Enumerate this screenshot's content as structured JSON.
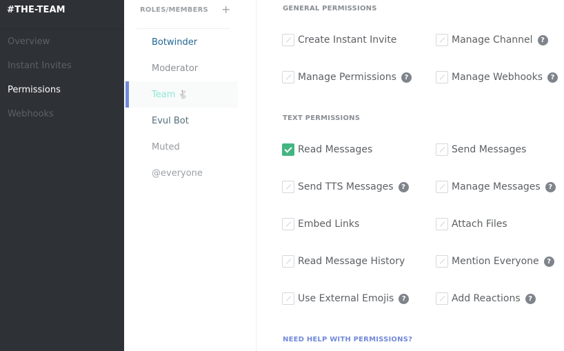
{
  "sidebar": {
    "title": "#THE-TEAM",
    "items": [
      {
        "label": "Overview",
        "active": false
      },
      {
        "label": "Instant Invites",
        "active": false
      },
      {
        "label": "Permissions",
        "active": true
      },
      {
        "label": "Webhooks",
        "active": false
      }
    ]
  },
  "roles": {
    "header": "ROLES/MEMBERS",
    "add_icon": "+",
    "items": [
      {
        "label": "Botwinder",
        "color": "#206694",
        "active": false,
        "badge": ""
      },
      {
        "label": "Moderator",
        "color": "#8a8e94",
        "active": false,
        "badge": ""
      },
      {
        "label": "Team",
        "color": "#8ee8d7",
        "active": true,
        "badge": "🐇"
      },
      {
        "label": "Evul Bot",
        "color": "#546e7a",
        "active": false,
        "badge": ""
      },
      {
        "label": "Muted",
        "color": "#95999e",
        "active": false,
        "badge": ""
      },
      {
        "label": "@everyone",
        "color": "#9ba0a6",
        "active": false,
        "badge": ""
      }
    ]
  },
  "permissions": {
    "general_header": "GENERAL PERMISSIONS",
    "general": [
      {
        "label": "Create Instant Invite",
        "state": "neutral",
        "help": false
      },
      {
        "label": "Manage Channel",
        "state": "neutral",
        "help": true
      },
      {
        "label": "Manage Permissions",
        "state": "neutral",
        "help": true
      },
      {
        "label": "Manage Webhooks",
        "state": "neutral",
        "help": true
      }
    ],
    "text_header": "TEXT PERMISSIONS",
    "text": [
      {
        "label": "Read Messages",
        "state": "allowed",
        "help": false
      },
      {
        "label": "Send Messages",
        "state": "neutral",
        "help": false
      },
      {
        "label": "Send TTS Messages",
        "state": "neutral",
        "help": true
      },
      {
        "label": "Manage Messages",
        "state": "neutral",
        "help": true
      },
      {
        "label": "Embed Links",
        "state": "neutral",
        "help": false
      },
      {
        "label": "Attach Files",
        "state": "neutral",
        "help": false
      },
      {
        "label": "Read Message History",
        "state": "neutral",
        "help": false
      },
      {
        "label": "Mention Everyone",
        "state": "neutral",
        "help": true
      },
      {
        "label": "Use External Emojis",
        "state": "neutral",
        "help": true
      },
      {
        "label": "Add Reactions",
        "state": "neutral",
        "help": true
      }
    ],
    "help_glyph": "?",
    "need_help_link": "NEED HELP WITH PERMISSIONS?"
  },
  "colors": {
    "accent": "#7289da",
    "allowed": "#43b581",
    "sidebar_bg": "#2e3136"
  }
}
